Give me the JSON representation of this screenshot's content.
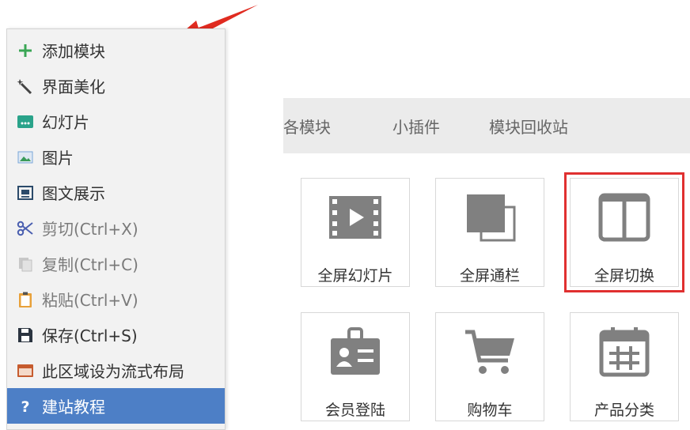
{
  "context_menu": {
    "items": [
      {
        "label": "添加模块",
        "icon": "plus-icon"
      },
      {
        "label": "界面美化",
        "icon": "magic-wand-icon"
      },
      {
        "label": "幻灯片",
        "icon": "slideshow-icon"
      },
      {
        "label": "图片",
        "icon": "image-icon"
      },
      {
        "label": "图文展示",
        "icon": "image-text-icon"
      },
      {
        "label": "剪切(Ctrl+X)",
        "icon": "scissors-icon"
      },
      {
        "label": "复制(Ctrl+C)",
        "icon": "copy-icon"
      },
      {
        "label": "粘贴(Ctrl+V)",
        "icon": "clipboard-icon"
      },
      {
        "label": "保存(Ctrl+S)",
        "icon": "save-icon"
      },
      {
        "label": "此区域设为流式布局",
        "icon": "layout-icon"
      },
      {
        "label": "建站教程",
        "icon": "help-icon"
      }
    ]
  },
  "tabs": [
    {
      "label": "各模块"
    },
    {
      "label": "小插件"
    },
    {
      "label": "模块回收站"
    }
  ],
  "modules": [
    {
      "label": "全屏幻灯片",
      "icon": "film-play-icon"
    },
    {
      "label": "全屏通栏",
      "icon": "layers-icon"
    },
    {
      "label": "全屏切换",
      "icon": "split-window-icon",
      "selected": true
    },
    {
      "label": "会员登陆",
      "icon": "member-card-icon"
    },
    {
      "label": "购物车",
      "icon": "shopping-cart-icon"
    },
    {
      "label": "产品分类",
      "icon": "calendar-grid-icon"
    }
  ],
  "colors": {
    "menu_active": "#4d7fc6",
    "selection_outline": "#e03030",
    "arrow": "#e02b20",
    "icon_gray": "#808080"
  }
}
